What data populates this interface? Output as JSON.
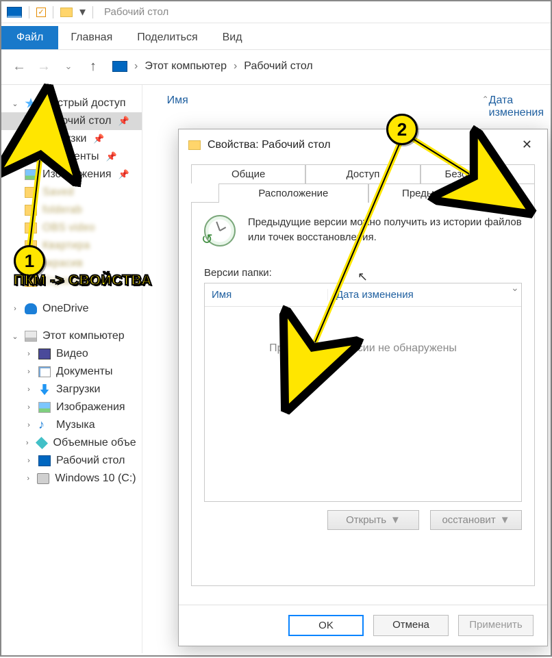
{
  "window": {
    "title": "Рабочий стол"
  },
  "ribbon": {
    "file": "Файл",
    "home": "Главная",
    "share": "Поделиться",
    "view": "Вид"
  },
  "address": {
    "root": "Этот компьютер",
    "folder": "Рабочий стол"
  },
  "columns": {
    "name": "Имя",
    "date": "Дата изменения"
  },
  "nav": {
    "quick": "Быстрый доступ",
    "items_pinned": [
      {
        "label": "Рабочий стол",
        "icon": "desk"
      },
      {
        "label": "Загрузки",
        "icon": "down"
      },
      {
        "label": "Документы",
        "icon": "doc"
      },
      {
        "label": "Изображения",
        "icon": "img"
      }
    ],
    "onedrive": "OneDrive",
    "thispc": "Этот компьютер",
    "pc_items": [
      {
        "label": "Видео",
        "icon": "vid"
      },
      {
        "label": "Документы",
        "icon": "doc"
      },
      {
        "label": "Загрузки",
        "icon": "down"
      },
      {
        "label": "Изображения",
        "icon": "img"
      },
      {
        "label": "Музыка",
        "icon": "mus"
      },
      {
        "label": "Объемные объе",
        "icon": "cube"
      },
      {
        "label": "Рабочий стол",
        "icon": "desk"
      },
      {
        "label": "Windows 10 (C:)",
        "icon": "disk"
      }
    ]
  },
  "dialog": {
    "title": "Свойства: Рабочий стол",
    "tabs": {
      "general": "Общие",
      "sharing": "Доступ",
      "security": "Безопасность",
      "location": "Расположение",
      "previous": "Предыдущие версии"
    },
    "desc": "Предыдущие версии можно получить из истории файлов или точек восстановления.",
    "versions_label": "Версии папки:",
    "ver_col_name": "Имя",
    "ver_col_date": "Дата изменения",
    "empty_msg": "Предыдущие версии не обнаружены",
    "open_btn": "Открыть",
    "restore_btn": "осстановит",
    "ok": "OK",
    "cancel": "Отмена",
    "apply": "Применить"
  },
  "annotation": {
    "marker1": "1",
    "marker2": "2",
    "hint": "ПКМ -> СВОЙСТВА"
  }
}
